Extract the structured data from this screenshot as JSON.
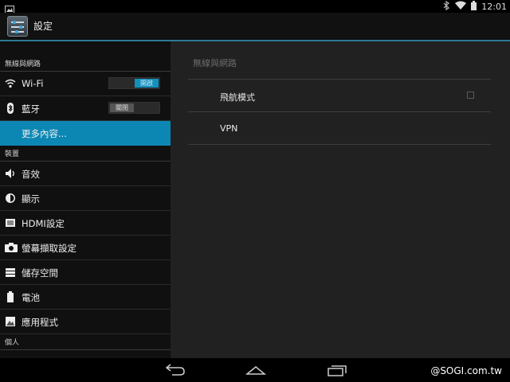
{
  "status_bar": {
    "time": "12:01"
  },
  "action_bar": {
    "title": "設定"
  },
  "sidebar": {
    "sections": [
      {
        "header": "無線與網路"
      },
      {
        "header": "裝置"
      },
      {
        "header": "個人"
      }
    ],
    "items": [
      {
        "label": "Wi-Fi",
        "icon": "wifi-icon",
        "toggle": "開啟",
        "toggle_state": "on"
      },
      {
        "label": "藍牙",
        "icon": "bluetooth-icon",
        "toggle": "關閉",
        "toggle_state": "off"
      },
      {
        "label": "更多內容...",
        "selected": true
      },
      {
        "label": "音效",
        "icon": "speaker-icon"
      },
      {
        "label": "顯示",
        "icon": "brightness-icon"
      },
      {
        "label": "HDMI設定",
        "icon": "hdmi-icon"
      },
      {
        "label": "螢幕擷取設定",
        "icon": "camera-icon"
      },
      {
        "label": "儲存空間",
        "icon": "storage-icon"
      },
      {
        "label": "電池",
        "icon": "battery-icon"
      },
      {
        "label": "應用程式",
        "icon": "apps-icon"
      }
    ]
  },
  "detail": {
    "header": "無線與網路",
    "items": [
      {
        "label": "飛航模式",
        "checked": false
      },
      {
        "label": "VPN"
      }
    ]
  },
  "nav_bar": {
    "watermark": "@SOGI.com.tw"
  },
  "colors": {
    "accent": "#0c87b3",
    "divider": "#2b7a96"
  }
}
